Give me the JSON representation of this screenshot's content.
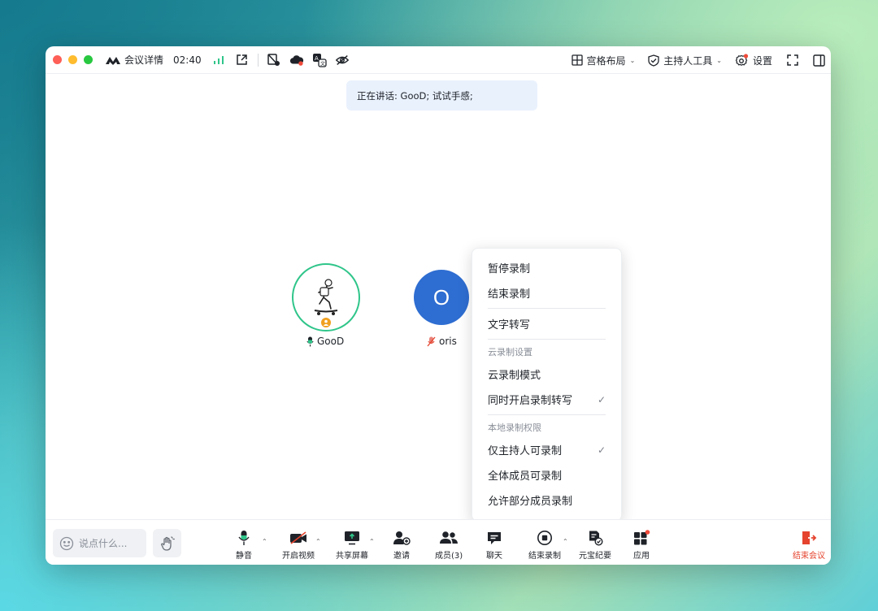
{
  "titlebar": {
    "meeting_details_label": "会议详情",
    "timer": "02:40",
    "layout_label": "宫格布局",
    "host_tools_label": "主持人工具",
    "settings_label": "设置"
  },
  "speaking_banner": {
    "text": "正在讲话: GooD; 试试手感;"
  },
  "participants": [
    {
      "name": "GooD",
      "role": "host",
      "avatar_initial": ""
    },
    {
      "name": "oris",
      "role": "member",
      "avatar_initial": "O"
    }
  ],
  "record_menu": {
    "items": [
      {
        "label": "暂停录制"
      },
      {
        "label": "结束录制"
      },
      {
        "label": "文字转写"
      }
    ],
    "cloud_section": {
      "header": "云录制设置",
      "items": [
        {
          "label": "云录制模式",
          "checked": false
        },
        {
          "label": "同时开启录制转写",
          "checked": true
        }
      ]
    },
    "local_section": {
      "header": "本地录制权限",
      "items": [
        {
          "label": "仅主持人可录制",
          "checked": true
        },
        {
          "label": "全体成员可录制",
          "checked": false
        },
        {
          "label": "允许部分成员录制",
          "checked": false
        }
      ]
    },
    "check_glyph": "✓"
  },
  "toolbar": {
    "chat_placeholder": "说点什么...",
    "mute_label": "静音",
    "video_label": "开启视频",
    "share_label": "共享屏幕",
    "invite_label": "邀请",
    "members_label": "成员(3)",
    "chat_label": "聊天",
    "end_record_label": "结束录制",
    "yuanbao_label": "元宝纪要",
    "apps_label": "应用",
    "end_meeting_label": "结束会议"
  },
  "colors": {
    "accent_green": "#2fc58a",
    "avatar_blue": "#2e6dd1",
    "end_red": "#e5432d",
    "banner_bg": "#e9f1fd",
    "notification_dot": "#f04a3a"
  }
}
